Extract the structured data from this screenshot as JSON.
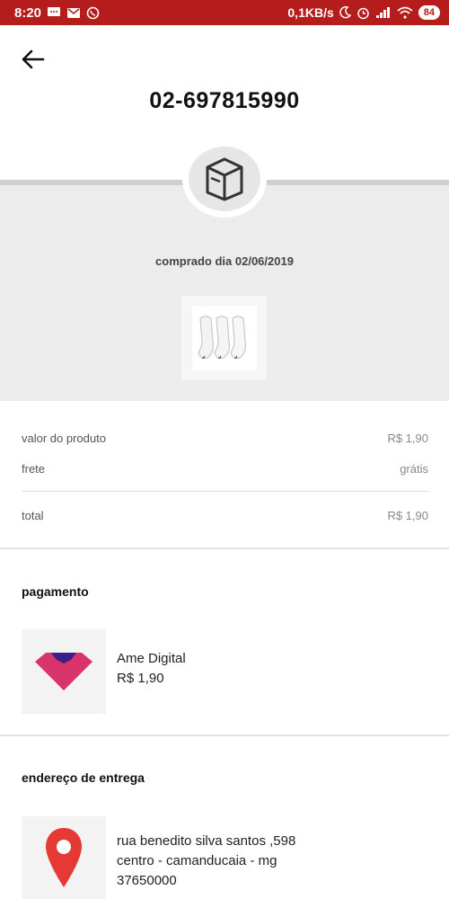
{
  "status_bar": {
    "time": "8:20",
    "speed": "0,1KB/s",
    "battery": "84"
  },
  "header": {
    "order_number": "02-697815990"
  },
  "order": {
    "purchased_label": "comprado dia 02/06/2019"
  },
  "summary": {
    "product_label": "valor do produto",
    "product_value": "R$ 1,90",
    "shipping_label": "frete",
    "shipping_value": "grátis",
    "total_label": "total",
    "total_value": "R$ 1,90"
  },
  "payment": {
    "title": "pagamento",
    "method": "Ame Digital",
    "amount": "R$ 1,90"
  },
  "delivery": {
    "title": "endereço de entrega",
    "street": "rua benedito silva santos ,598",
    "district": "centro - camanducaia - mg",
    "zip": "37650000"
  },
  "colors": {
    "status_bar": "#b51c1c",
    "ame_brand": "#d8336a",
    "pin": "#e53935"
  }
}
